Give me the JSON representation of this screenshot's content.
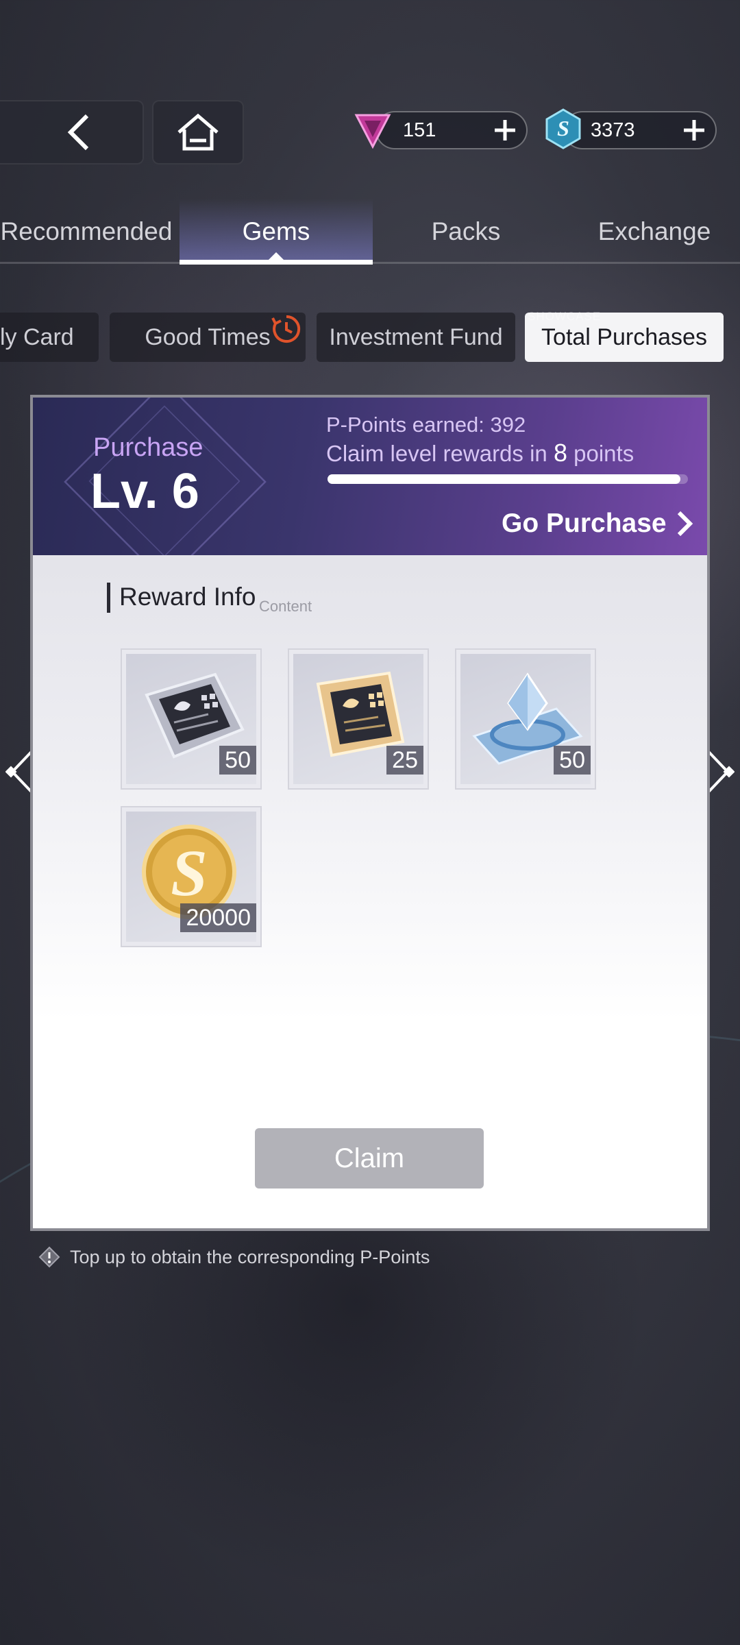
{
  "currency": {
    "gems": "151",
    "coins": "3373"
  },
  "tabs": [
    {
      "label": "Recommended"
    },
    {
      "label": "Gems"
    },
    {
      "label": "Packs"
    },
    {
      "label": "Exchange"
    }
  ],
  "subtabs": {
    "card": "ly Card",
    "good_times": "Good Times",
    "investment_fund": "Investment Fund",
    "total_purchases": "Total Purchases",
    "showcase_tag": "SHOWCASE"
  },
  "panel": {
    "purchase_label": "Purchase",
    "level": "Lv. 6",
    "points_earned": "P-Points earned: 392",
    "claim_prefix": "Claim level rewards in",
    "claim_points": "8",
    "claim_suffix": "points",
    "progress": 0.98,
    "go_purchase": "Go Purchase",
    "reward_title": "Reward Info",
    "reward_subtitle": "Content",
    "rewards": [
      {
        "name": "silver-chip",
        "qty": "50"
      },
      {
        "name": "gold-chip",
        "qty": "25"
      },
      {
        "name": "crystal-shard",
        "qty": "50"
      },
      {
        "name": "s-coin",
        "qty": "20000"
      }
    ],
    "claim_button": "Claim"
  },
  "tip": "Top up to obtain the corresponding P-Points",
  "colors": {
    "accent": "#7a4aac",
    "header_start": "#2a2a55",
    "claim_disabled": "#b2b2b8"
  }
}
